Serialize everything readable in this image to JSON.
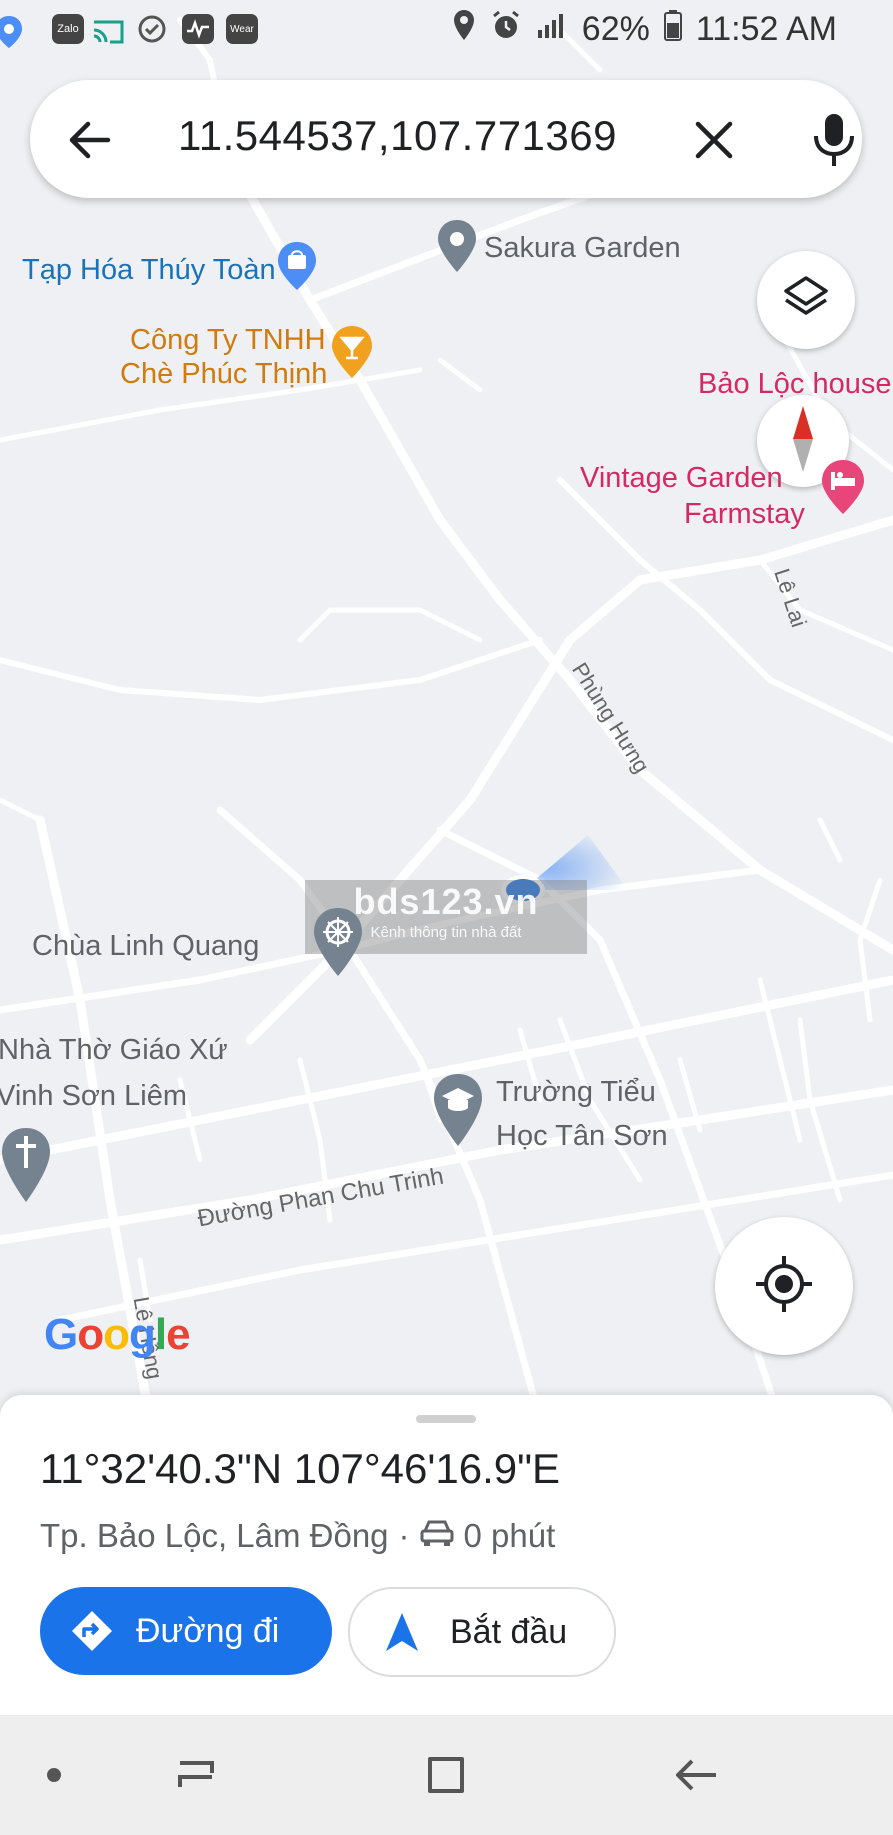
{
  "status_bar": {
    "time": "11:52 AM",
    "battery": "62%",
    "left_icons": [
      "location-pin-icon",
      "zalo-icon",
      "cast-icon",
      "check-circle-icon",
      "pulse-icon",
      "wear-icon"
    ],
    "zalo_label": "Zalo",
    "wear_label": "Wear"
  },
  "search": {
    "query": "11.544537,107.771369",
    "back_icon": "back-arrow-icon",
    "clear_icon": "close-icon",
    "mic_icon": "mic-icon"
  },
  "map": {
    "labels": {
      "tap_hoa": "Tạp Hóa Thúy Toàn",
      "sakura": "Sakura Garden",
      "cong_ty_1": "Công Ty TNHH",
      "cong_ty_2": "Chè Phúc Thịnh",
      "bao_loc_house": "Bảo Lộc house",
      "vintage_1": "Vintage Garden",
      "vintage_2": "Farmstay",
      "le_lai": "Lê Lai",
      "phung_hung": "Phùng Hưng",
      "chua": "Chùa Linh Quang",
      "nha_tho_1": "Nhà Thờ Giáo Xứ",
      "nha_tho_2": "Vinh Sơn Liêm",
      "truong_1": "Trường Tiểu",
      "truong_2": "Học Tân Sơn",
      "phan_chu_trinh": "Đường Phan Chu Trinh",
      "le_hong": "Lê Hồng"
    },
    "watermark_title": "bds123.vn",
    "watermark_sub": "Kênh thông tin nhà đất",
    "google_logo": "Google",
    "colors": {
      "map_bg": "#eef0f3",
      "road": "#ffffff",
      "poi_blue": "#1a73b8",
      "poi_orange": "#d07a10",
      "poi_pink": "#d42a64",
      "location_dot": "#1a73e8"
    }
  },
  "sheet": {
    "coordinates": "11°32'40.3\"N 107°46'16.9\"E",
    "place": "Tp. Bảo Lộc, Lâm Đồng",
    "separator": "·",
    "travel_time": "0 phút",
    "directions_label": "Đường đi",
    "start_label": "Bắt đầu"
  },
  "nav": {
    "icons": [
      "dot-icon",
      "recent-apps-icon",
      "home-icon",
      "back-icon"
    ]
  }
}
